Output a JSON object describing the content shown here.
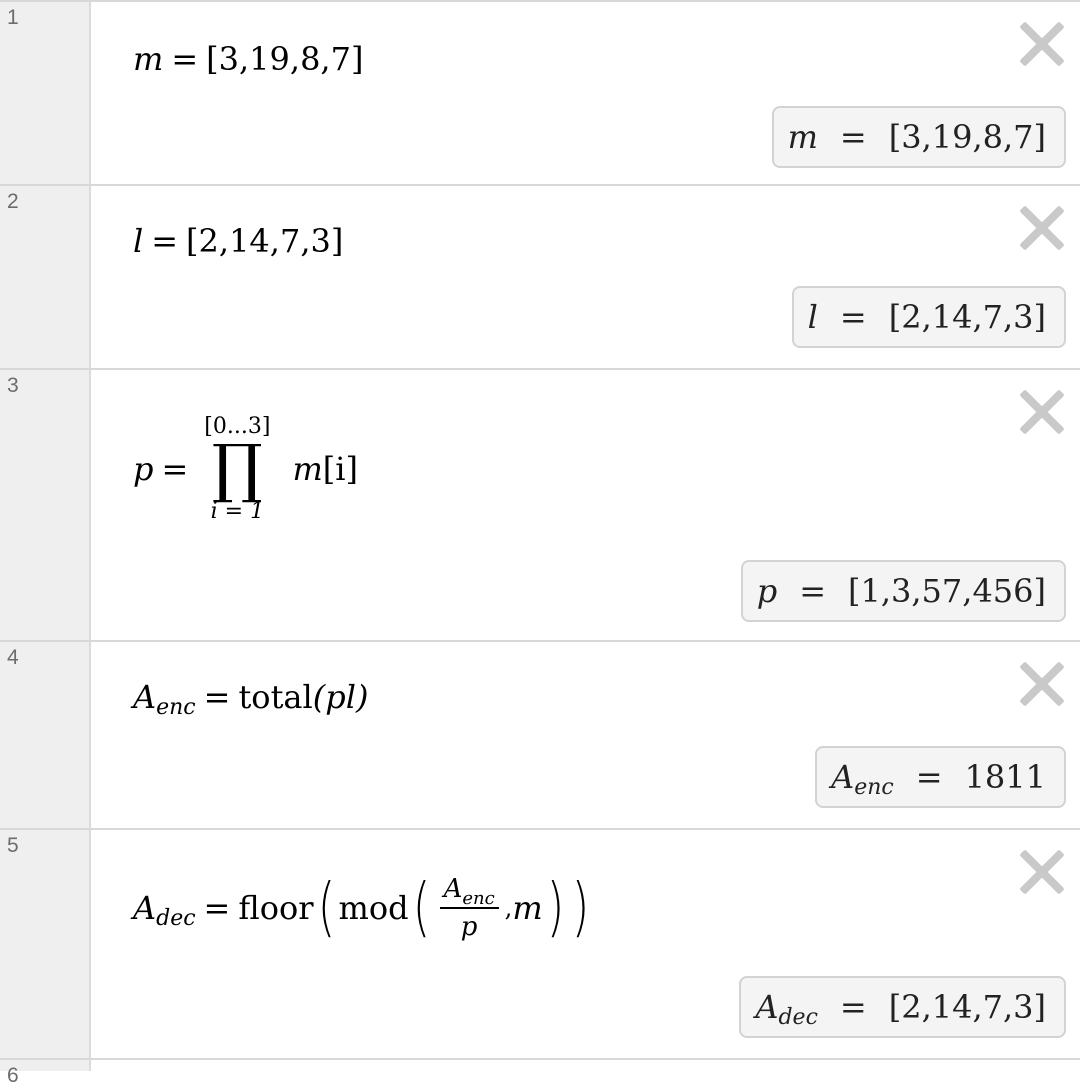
{
  "rows": [
    {
      "index": "1",
      "lhs": "m",
      "equals": "=",
      "rhs": "[3,19,8,7]",
      "result": {
        "var": "m",
        "equals": "=",
        "value": "[3,19,8,7]"
      }
    },
    {
      "index": "2",
      "lhs": "l",
      "equals": "=",
      "rhs": "[2,14,7,3]",
      "result": {
        "var": "l",
        "equals": "=",
        "value": "[2,14,7,3]"
      }
    },
    {
      "index": "3",
      "lhs": "p",
      "equals": "=",
      "upper": "[0...3]",
      "lower": "i = 1",
      "body_var": "m",
      "body_index": "[i]",
      "result": {
        "var": "p",
        "equals": "=",
        "value": "[1,3,57,456]"
      }
    },
    {
      "index": "4",
      "lhs": "A",
      "lhs_sub": "enc",
      "equals": "=",
      "fn": "total",
      "args": "(pl)",
      "result": {
        "var": "A",
        "var_sub": "enc",
        "equals": "=",
        "value": "1811"
      }
    },
    {
      "index": "5",
      "lhs": "A",
      "lhs_sub": "dec",
      "equals": "=",
      "fn_outer": "floor",
      "fn_inner": "mod",
      "num_var": "A",
      "num_sub": "enc",
      "den": "p",
      "comma": ",",
      "second_arg": "m",
      "result": {
        "var": "A",
        "var_sub": "dec",
        "equals": "=",
        "value": "[2,14,7,3]"
      }
    },
    {
      "index": "6"
    }
  ],
  "icons": {
    "delete": "close-icon"
  },
  "colors": {
    "gutter": "#efefef",
    "result_bg": "#f4f4f4",
    "close": "#c9c9c9"
  }
}
